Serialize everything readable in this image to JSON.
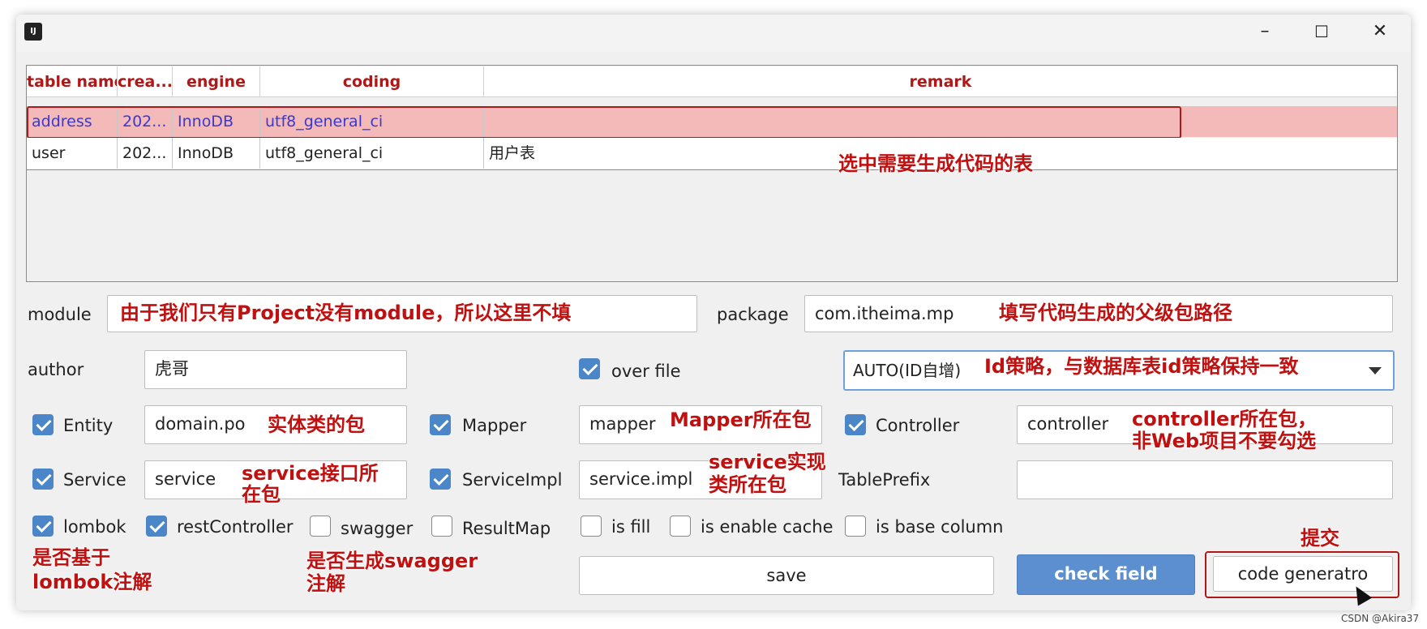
{
  "window": {
    "icon_text": "IJ",
    "minimize": "–",
    "maximize": "☐",
    "close": "✕"
  },
  "table": {
    "headers": [
      "table name",
      "crea...",
      "engine",
      "coding",
      "remark"
    ],
    "rows": [
      {
        "name": "address",
        "created": "202...",
        "engine": "InnoDB",
        "coding": "utf8_general_ci",
        "remark": ""
      },
      {
        "name": "user",
        "created": "202...",
        "engine": "InnoDB",
        "coding": "utf8_general_ci",
        "remark": "用户表"
      }
    ]
  },
  "form": {
    "module_label": "module",
    "module_value": "",
    "package_label": "package",
    "package_value": "com.itheima.mp",
    "author_label": "author",
    "author_value": "虎哥",
    "over_file_label": "over file",
    "id_strategy_value": "AUTO(ID自增)",
    "entity_label": "Entity",
    "entity_value": "domain.po",
    "mapper_label": "Mapper",
    "mapper_value": "mapper",
    "controller_label": "Controller",
    "controller_value": "controller",
    "service_label": "Service",
    "service_value": "service",
    "serviceimpl_label": "ServiceImpl",
    "serviceimpl_value": "service.impl",
    "tableprefix_label": "TablePrefix",
    "tableprefix_value": "",
    "lombok_label": "lombok",
    "restcontroller_label": "restController",
    "swagger_label": "swagger",
    "resultmap_label": "ResultMap",
    "isfill_label": "is fill",
    "enablecache_label": "is enable cache",
    "basecolumn_label": "is base column",
    "save_label": "save",
    "checkfield_label": "check field",
    "generate_label": "code generatro"
  },
  "annotations": {
    "select_table": "选中需要生成代码的表",
    "module_note": "由于我们只有Project没有module，所以这里不填",
    "package_note": "填写代码生成的父级包路径",
    "id_note": "Id策略，与数据库表id策略保持一致",
    "entity_note": "实体类的包",
    "mapper_note": "Mapper所在包",
    "controller_note_1": "controller所在包，",
    "controller_note_2": "非Web项目不要勾选",
    "service_note_1": "service接口所",
    "service_note_2": "在包",
    "serviceimpl_note_1": "service实现",
    "serviceimpl_note_2": "类所在包",
    "lombok_note_1": "是否基于",
    "lombok_note_2": "lombok注解",
    "swagger_note_1": "是否生成swagger",
    "swagger_note_2": "注解",
    "submit_note": "提交"
  },
  "watermark": "CSDN @Akira37",
  "colors": {
    "accent": "#5b8fd0",
    "annotation": "#c01010",
    "selected_row": "#f4b9b9"
  }
}
